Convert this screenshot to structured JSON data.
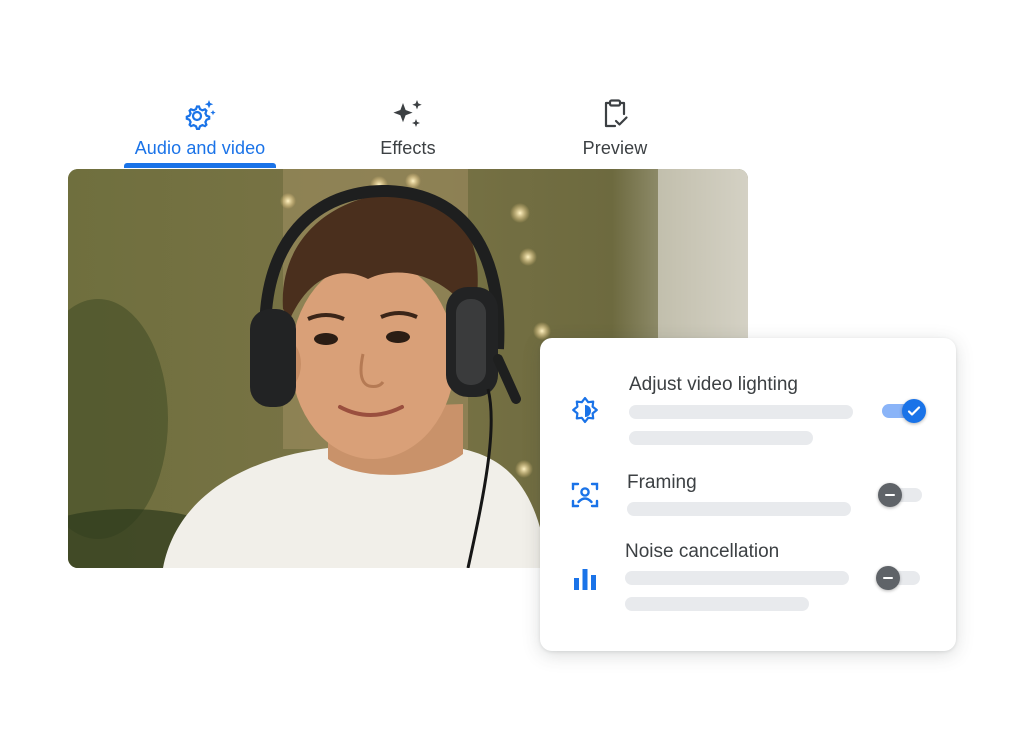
{
  "tabs": [
    {
      "label": "Audio and video",
      "icon": "gear-sparkle-icon",
      "active": true
    },
    {
      "label": "Effects",
      "icon": "sparkles-icon",
      "active": false
    },
    {
      "label": "Preview",
      "icon": "clipboard-check-icon",
      "active": false
    }
  ],
  "settings": [
    {
      "title": "Adjust video lighting",
      "icon": "brightness-icon",
      "enabled": true
    },
    {
      "title": "Framing",
      "icon": "framing-person-icon",
      "enabled": false
    },
    {
      "title": "Noise cancellation",
      "icon": "bar-graph-icon",
      "enabled": false
    }
  ],
  "colors": {
    "accent": "#1a73e8",
    "text": "#3c4043",
    "placeholder": "#e8eaed"
  }
}
